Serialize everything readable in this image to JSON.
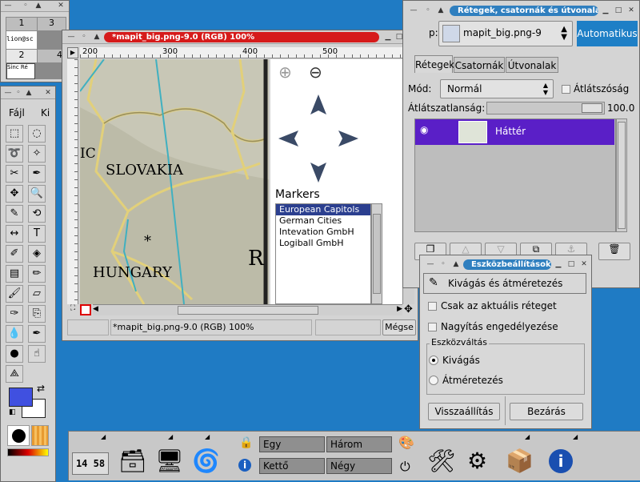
{
  "layers_dialog": {
    "title": "Rétegek, csatornák és útvonalak",
    "image_label": "p:",
    "image_name": "mapit_big.png-9",
    "auto_button": "Automatikus",
    "tabs": [
      "Rétegek",
      "Csatornák",
      "Útvonalak"
    ],
    "mode_label": "Mód:",
    "mode_value": "Normál",
    "keep_trans_label": "Átlátszóság",
    "opacity_label": "Átlátszatlanság:",
    "opacity_value": "100.0",
    "layer_name": "Háttér"
  },
  "image_window": {
    "title": "*mapit_big.png-9.0 (RGB) 100%",
    "ruler_labels": [
      "200",
      "300",
      "400",
      "500"
    ],
    "map_labels": [
      "SLOVAKIA",
      "HUNGARY",
      "IC",
      "R"
    ],
    "markers_heading": "Markers",
    "markers": [
      "European Capitols",
      "German Cities",
      "Intevation GmbH",
      "Logiball GmbH"
    ],
    "status_text": "*mapit_big.png-9.0 (RGB) 100%",
    "cancel_label": "Mégse"
  },
  "toolbox": {
    "menu": [
      "Fájl",
      "Ki"
    ],
    "tools": [
      "rect-select",
      "ellipse-select",
      "lasso",
      "fuzzy-select",
      "scissors",
      "paths",
      "move",
      "magnify",
      "crop",
      "transform",
      "flip",
      "text",
      "color-picker",
      "bucket-fill",
      "blend",
      "pencil",
      "paintbrush",
      "eraser",
      "airbrush",
      "clone",
      "convolve",
      "ink",
      "dodge-burn",
      "smudge",
      "measure"
    ],
    "fg_color": "#4050e0",
    "bg_color": "#ffffff"
  },
  "small_window": {
    "cells": [
      "1",
      "3",
      "lion@sc",
      "2",
      "4"
    ],
    "mini_label": "Sinc Ré"
  },
  "tool_options": {
    "title": "Eszközbeállítások",
    "tool_name": "Kivágás és átméretezés",
    "current_layer_label": "Csak az aktuális réteget",
    "allow_enlarge_label": "Nagyítás engedélyezése",
    "toggle_group_label": "Eszközváltás",
    "radio_crop": "Kivágás",
    "radio_resize": "Átméretezés",
    "reset_label": "Visszaállítás",
    "close_label": "Bezárás"
  },
  "panel": {
    "clock": "14 58",
    "workspaces": [
      "Egy",
      "Három",
      "Kettő",
      "Négy"
    ]
  }
}
